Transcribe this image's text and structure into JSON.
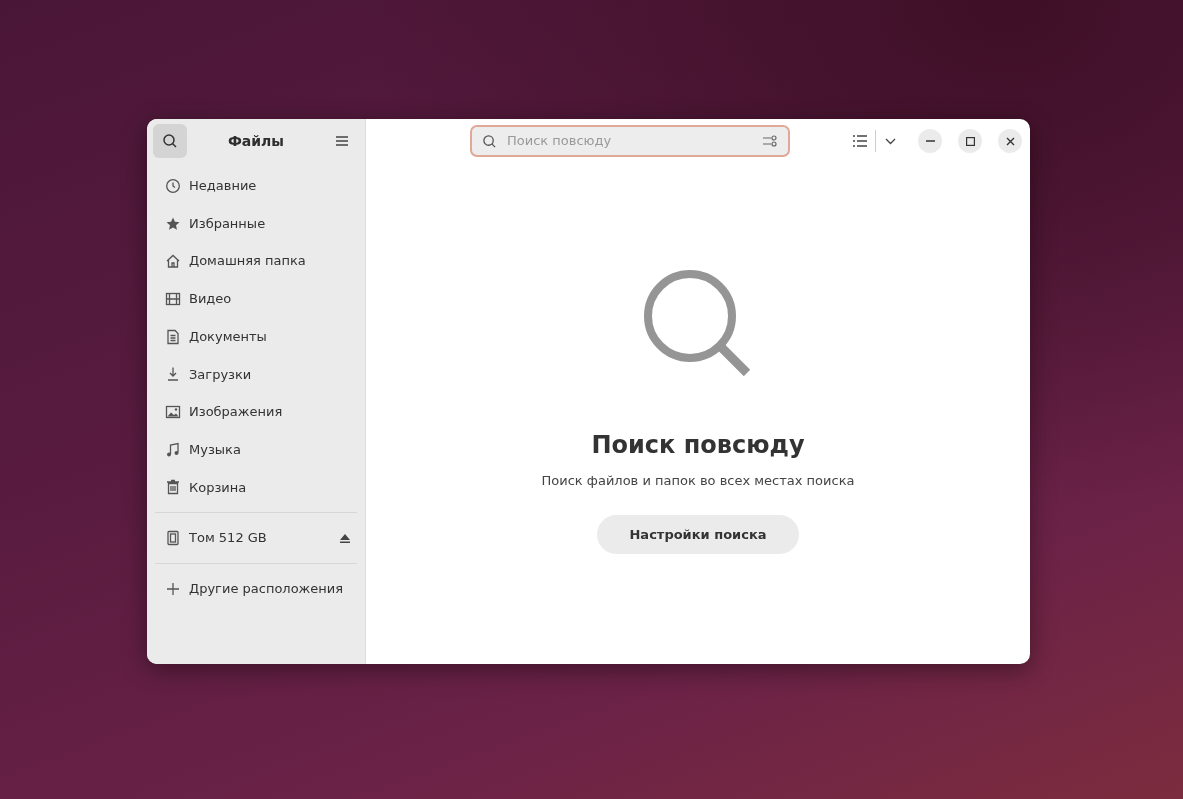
{
  "sidebar": {
    "search_toggle": {
      "selected": true
    },
    "title": "Файлы",
    "places": [
      {
        "kind": "recent",
        "label": "Недавние"
      },
      {
        "kind": "starred",
        "label": "Избранные"
      },
      {
        "kind": "home",
        "label": "Домашняя папка"
      },
      {
        "kind": "video",
        "label": "Видео"
      },
      {
        "kind": "documents",
        "label": "Документы"
      },
      {
        "kind": "downloads",
        "label": "Загрузки"
      },
      {
        "kind": "pictures",
        "label": "Изображения"
      },
      {
        "kind": "music",
        "label": "Музыка"
      },
      {
        "kind": "trash",
        "label": "Корзина"
      }
    ],
    "volumes": [
      {
        "label": "Том 512 GB"
      }
    ],
    "other": {
      "label": "Другие расположения"
    }
  },
  "search": {
    "placeholder": "Поиск повсюду"
  },
  "empty_state": {
    "title": "Поиск повсюду",
    "description": "Поиск файлов и папок во всех местах поиска",
    "button": "Настройки поиска"
  }
}
